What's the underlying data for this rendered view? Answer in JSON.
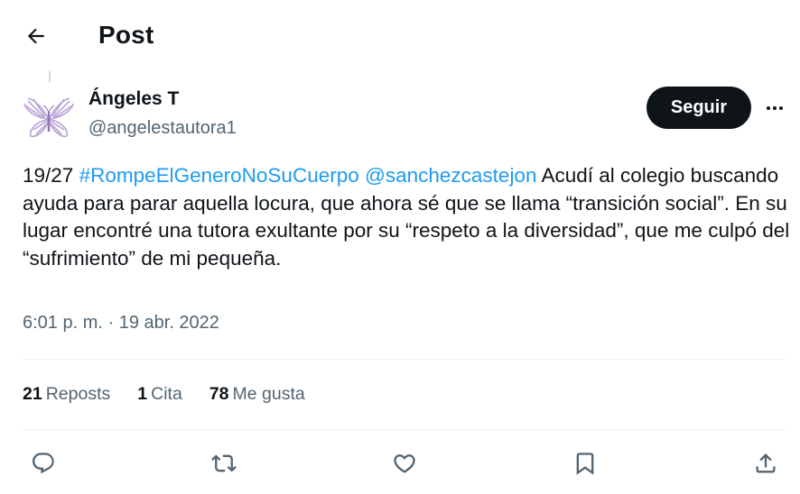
{
  "header": {
    "title": "Post"
  },
  "author": {
    "name": "Ángeles T",
    "handle": "@angelestautora1",
    "avatar_icon": "butterfly-icon",
    "follow_label": "Seguir"
  },
  "tweet": {
    "prefix": "19/27 ",
    "hashtag": "#RompeElGeneroNoSuCuerpo",
    "space": " ",
    "mention": "@sanchezcastejon",
    "body": " Acudí al colegio buscando ayuda para parar aquella locura, que ahora sé que se llama “transición social”. En su lugar encontré una tutora exultante por su “respeto a la diversidad”, que me culpó del “sufrimiento” de mi pequeña.",
    "timestamp": "6:01 p. m. · 19 abr. 2022"
  },
  "stats": {
    "reposts_count": "21",
    "reposts_label": "Reposts",
    "quotes_count": "1",
    "quotes_label": "Cita",
    "likes_count": "78",
    "likes_label": "Me gusta"
  },
  "colors": {
    "link": "#1d9bf0",
    "text": "#0f1419",
    "secondary": "#536471",
    "divider": "#eff3f4",
    "avatar_accent": "#b9a3d6"
  },
  "actions": [
    "reply-icon",
    "repost-icon",
    "like-icon",
    "bookmark-icon",
    "share-icon"
  ]
}
